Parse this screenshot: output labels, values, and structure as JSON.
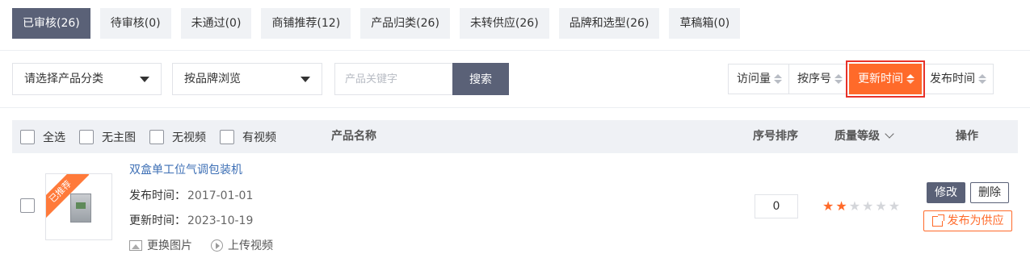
{
  "tabs": [
    {
      "label": "已审核(26)",
      "active": true
    },
    {
      "label": "待审核(0)",
      "active": false
    },
    {
      "label": "未通过(0)",
      "active": false
    },
    {
      "label": "商铺推荐(12)",
      "active": false
    },
    {
      "label": "产品归类(26)",
      "active": false
    },
    {
      "label": "未转供应(26)",
      "active": false
    },
    {
      "label": "品牌和选型(26)",
      "active": false
    },
    {
      "label": "草稿箱(0)",
      "active": false
    }
  ],
  "filters": {
    "category_select": "请选择产品分类",
    "brand_select": "按品牌浏览",
    "keyword_placeholder": "产品关键字",
    "search_label": "搜索"
  },
  "sort_buttons": [
    {
      "label": "访问量",
      "active": false
    },
    {
      "label": "按序号",
      "active": false
    },
    {
      "label": "更新时间",
      "active": true
    },
    {
      "label": "发布时间",
      "active": false
    }
  ],
  "table_header": {
    "select_all": "全选",
    "no_main_image": "无主图",
    "no_video": "无视频",
    "has_video": "有视频",
    "product_name": "产品名称",
    "sequence_sort": "序号排序",
    "quality_level": "质量等级",
    "actions": "操作"
  },
  "products": [
    {
      "badge": "已推荐",
      "name": "双盒单工位气调包装机",
      "publish_label": "发布时间：",
      "publish_date": "2017-01-01",
      "update_label": "更新时间：",
      "update_date": "2023-10-19",
      "change_image": "更换图片",
      "upload_video": "上传视频",
      "sequence": "0",
      "quality_stars": 2,
      "quality_max": 6,
      "edit_label": "修改",
      "delete_label": "删除",
      "publish_supply_label": "发布为供应"
    }
  ],
  "colors": {
    "accent": "#ff6a2a",
    "tab_active": "#5a6177",
    "link": "#3d6fb5"
  }
}
